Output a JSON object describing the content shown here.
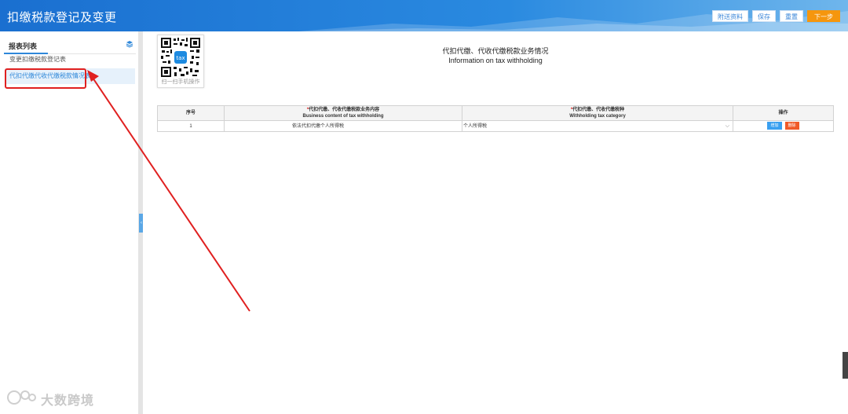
{
  "header": {
    "title": "扣缴税款登记及变更",
    "buttons": {
      "attachment": "附送资料",
      "save": "保存",
      "reset": "重置",
      "next": "下一步"
    }
  },
  "sidebar": {
    "title": "报表列表",
    "items": [
      {
        "label": "变更扣缴税款登记表"
      },
      {
        "label": "代扣代缴代收代缴税款情况表"
      }
    ]
  },
  "qr": {
    "caption": "扫一扫手机操作"
  },
  "main": {
    "title": "代扣代缴、代收代缴税款业务情况",
    "subtitle": "Information on tax withholding"
  },
  "table": {
    "headers": {
      "seq": "序号",
      "content_cn": "代扣代缴、代收代缴税款业务内容",
      "content_en": "Business content of tax withholding",
      "category_cn": "代扣代缴、代收代缴税种",
      "category_en": "Withholding tax category",
      "ops": "操作"
    },
    "required_mark": "*",
    "rows": [
      {
        "seq": "1",
        "content": "依法代扣代缴个人所得税",
        "category": "个人所得税",
        "add": "增加",
        "delete": "删除"
      }
    ]
  },
  "watermark": {
    "text": "大数跨境"
  },
  "colors": {
    "header_blue": "#1a6fd0",
    "accent_blue": "#2e87d9",
    "next_orange": "#f5960e",
    "annotation_red": "#e02020"
  }
}
